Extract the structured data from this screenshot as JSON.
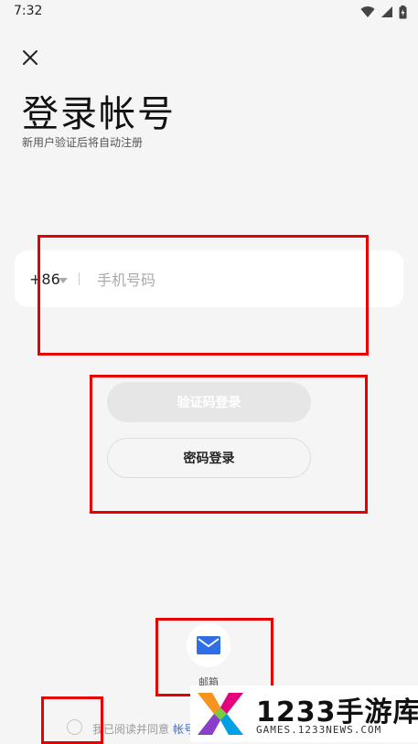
{
  "status_bar": {
    "time": "7:32",
    "icons": [
      "wifi-icon",
      "signal-icon",
      "battery-icon"
    ]
  },
  "header": {
    "close_icon": "close-icon",
    "title": "登录帐号",
    "subtitle": "新用户验证后将自动注册"
  },
  "phone_form": {
    "country_code": "+86",
    "placeholder": "手机号码",
    "value": ""
  },
  "buttons": {
    "sms_login": "验证码登录",
    "password_login": "密码登录"
  },
  "other_login": {
    "email_label": "邮箱",
    "email_icon": "mail-icon"
  },
  "agreement": {
    "prefix": "我已阅读并同意",
    "link": "帐号"
  },
  "watermark": {
    "main": "1233手游库",
    "sub": "GAMES.1233NEWS.COM"
  },
  "colors": {
    "background": "#f5f5f5",
    "accent": "#2f6ee5",
    "highlight": "#e60000",
    "disabled_button": "#e6e6e6"
  }
}
